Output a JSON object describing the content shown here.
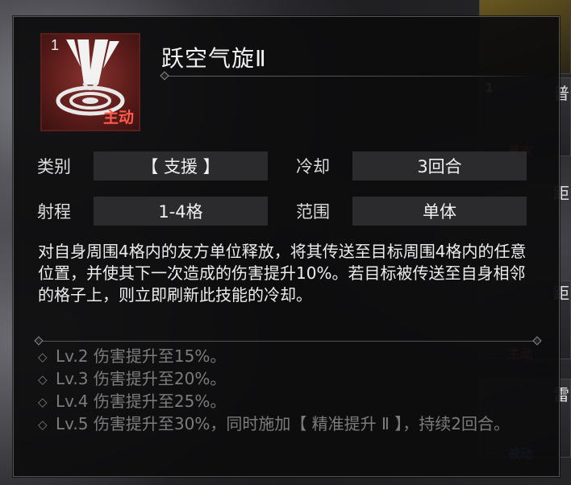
{
  "skill": {
    "level": "1",
    "name": "跃空气旋Ⅱ",
    "type_tag": "主动",
    "icon": "whirlwind-icon"
  },
  "stats": {
    "category_label": "类别",
    "category_value": "【 支援 】",
    "cooldown_label": "冷却",
    "cooldown_value": "3回合",
    "range_label": "射程",
    "range_value": "1-4格",
    "area_label": "范围",
    "area_value": "单体"
  },
  "description": "对自身周围4格内的友方单位释放，将其传送至目标周围4格内的任意位置，并使其下一次造成的伤害提升10%。若目标被传送至自身相邻的格子上，则立即刷新此技能的冷却。",
  "upgrades": [
    {
      "text": "Lv.2 伤害提升至15%。"
    },
    {
      "text": "Lv.3 伤害提升至20%。"
    },
    {
      "text": "Lv.4 伤害提升至25%。"
    },
    {
      "text": "Lv.5 伤害提升至30%，同时施加【 精准提升 Ⅱ 】，持续2回合。"
    }
  ],
  "background": {
    "side_tags": [
      "普攻",
      "主动",
      "被动"
    ],
    "side_level": "1",
    "edge_glyphs": [
      "普",
      "距",
      "距",
      "雷"
    ]
  },
  "colors": {
    "panel_bg": "#0c0c0d",
    "active_tag": "#ff5a4a",
    "upgrade_text": "#7c7c7c",
    "icon_bg": "#8a3430"
  }
}
